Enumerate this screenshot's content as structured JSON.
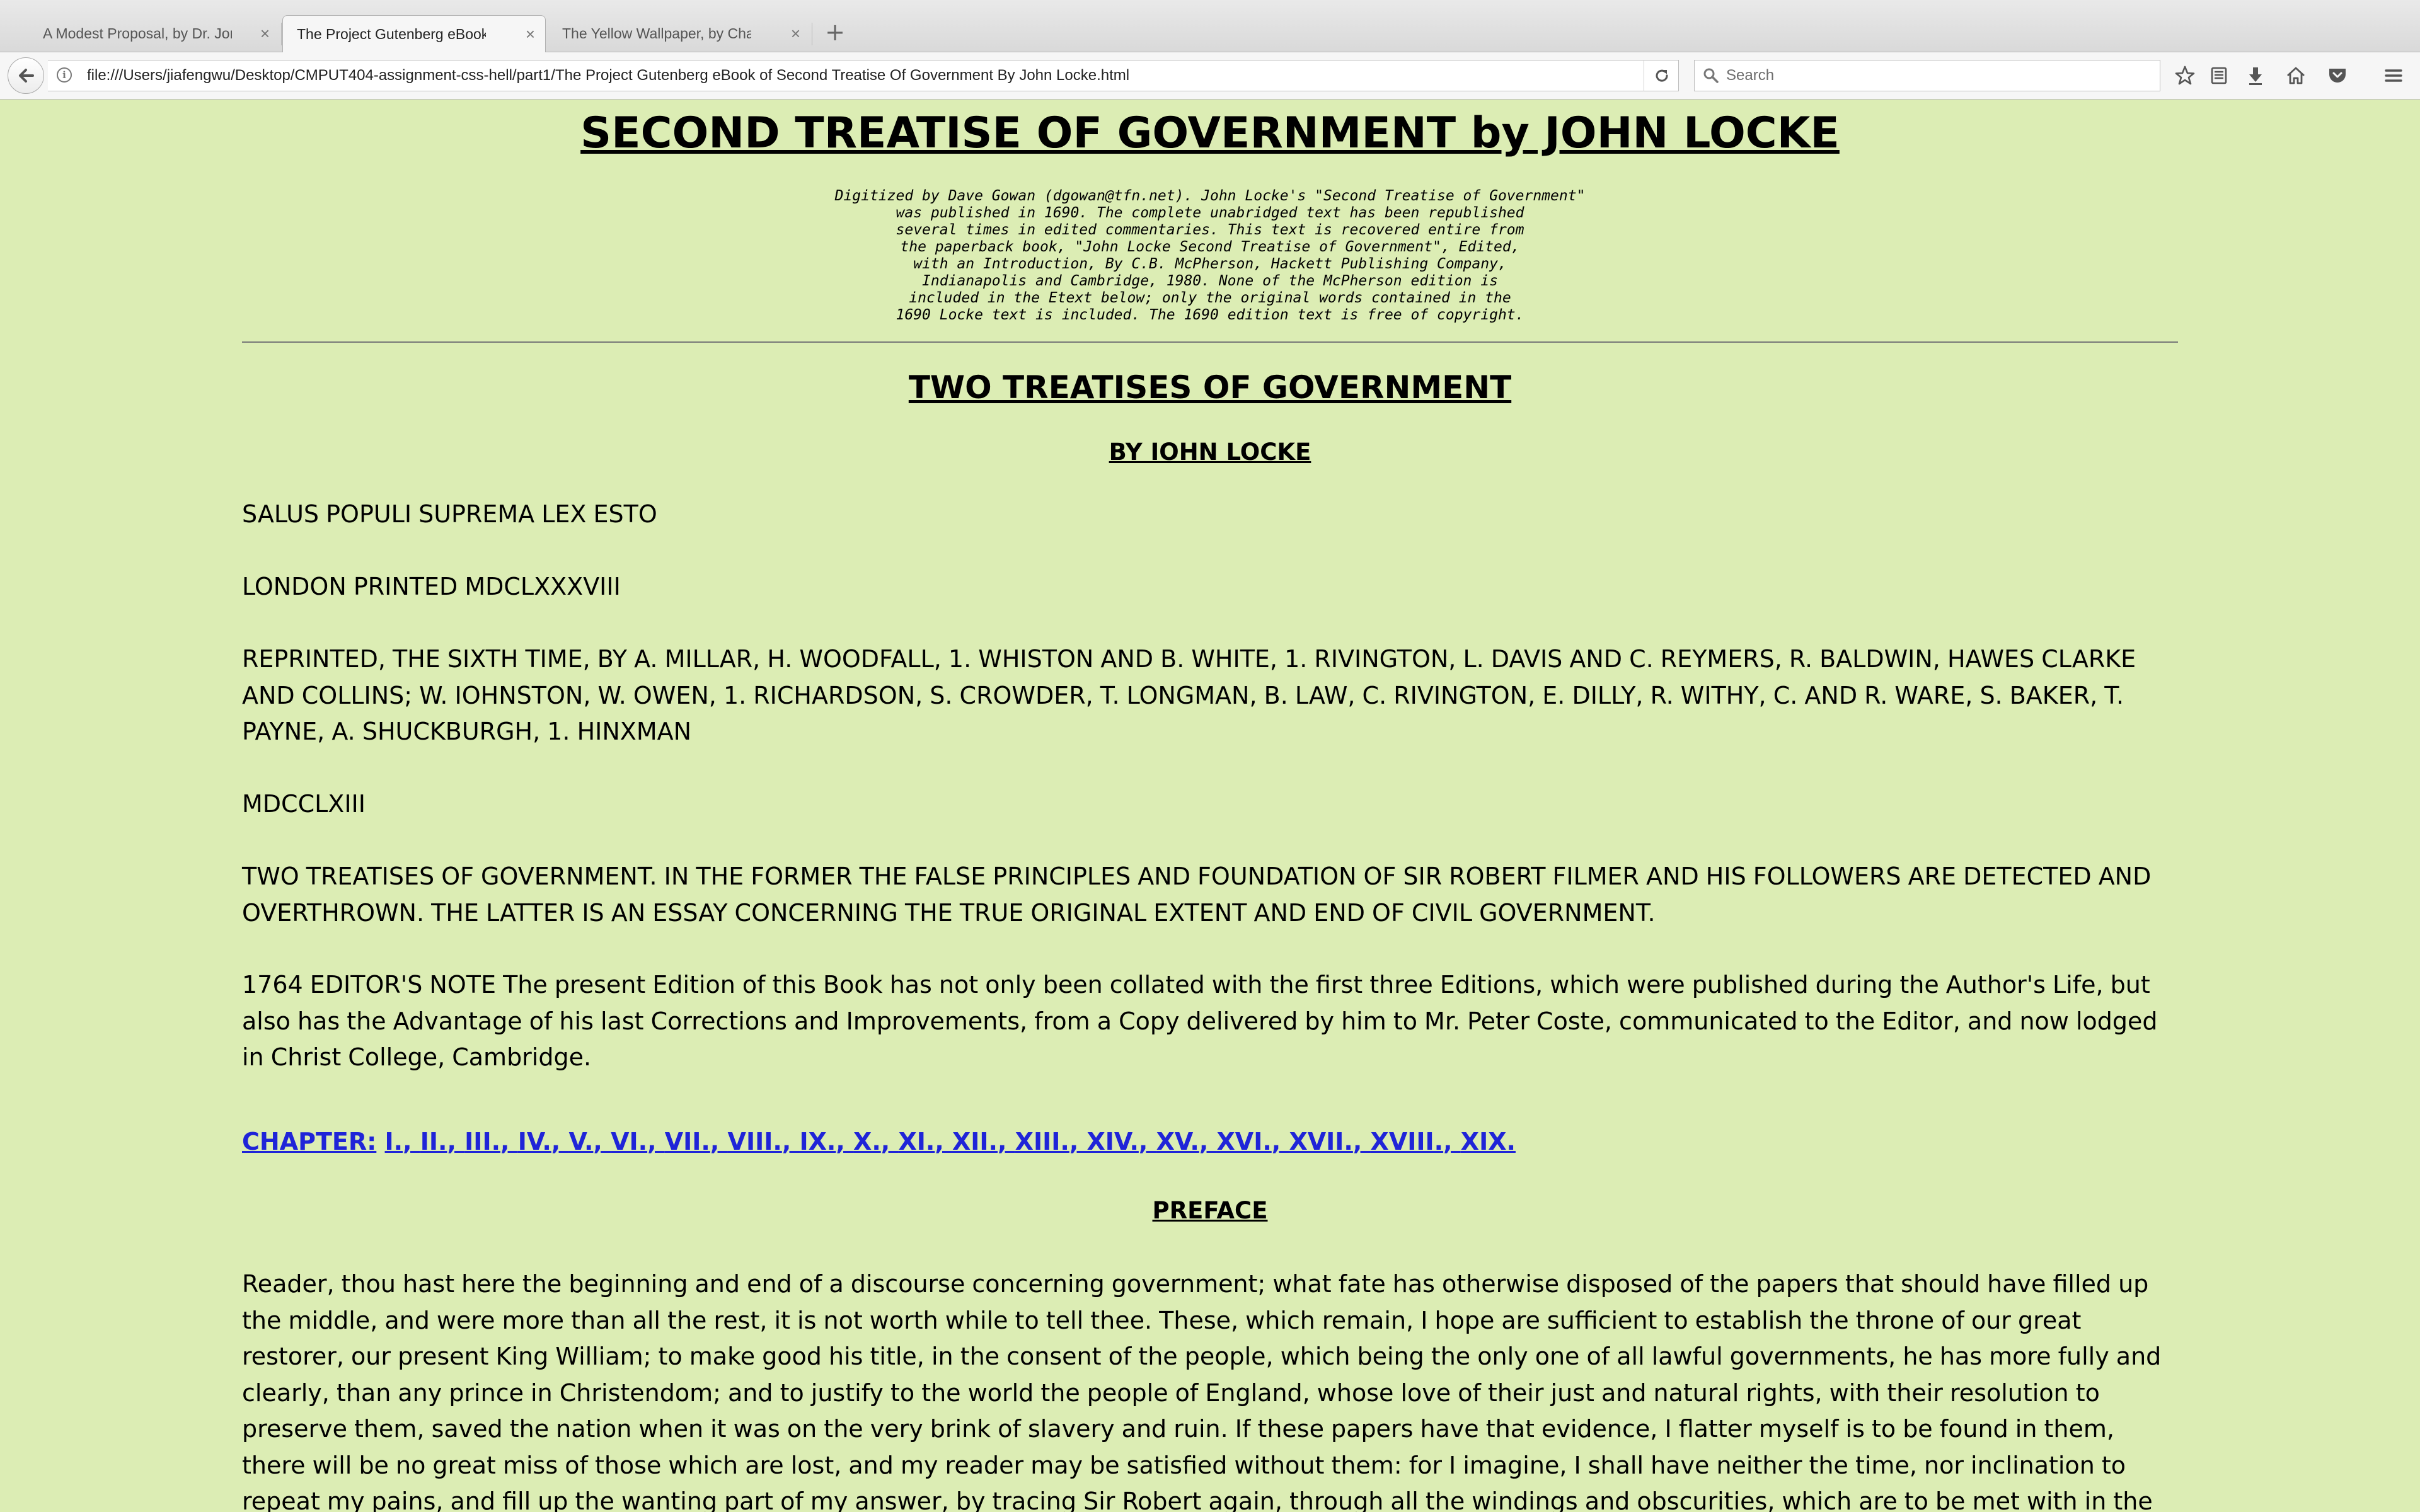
{
  "browser": {
    "tabs": [
      {
        "label": "A Modest Proposal, by Dr. Jona...",
        "active": false
      },
      {
        "label": "The Project Gutenberg eBook o...",
        "active": true
      },
      {
        "label": "The Yellow Wallpaper, by Charl...",
        "active": false
      }
    ],
    "close_glyph": "×",
    "new_tab_glyph": "+",
    "url": "file:///Users/jiafengwu/Desktop/CMPUT404-assignment-css-hell/part1/The Project Gutenberg eBook of Second Treatise Of Government By John Locke.html",
    "search_placeholder": "Search",
    "toolbar_icons": [
      "bookmark-star-icon",
      "reading-list-icon",
      "download-icon",
      "home-icon",
      "pocket-icon",
      "menu-icon"
    ]
  },
  "document": {
    "title": "SECOND TREATISE OF GOVERNMENT by JOHN LOCKE",
    "digitized_note": "Digitized by Dave Gowan (dgowan@tfn.net). John Locke's \"Second Treatise of Government\"\nwas published in 1690. The complete unabridged text has been republished\nseveral times in edited commentaries. This text is recovered entire from\nthe paperback book, \"John Locke Second Treatise of Government\", Edited,\nwith an Introduction, By C.B. McPherson, Hackett Publishing Company,\nIndianapolis and Cambridge, 1980. None of the McPherson edition is\nincluded in the Etext below; only the original words contained in the\n1690 Locke text is included. The 1690 edition text is free of copyright.",
    "heading": "TWO TREATISES OF GOVERNMENT",
    "byline": "BY IOHN LOCKE",
    "motto": "SALUS POPULI SUPREMA LEX ESTO",
    "imprint": "LONDON PRINTED MDCLXXXVIII",
    "reprint": "REPRINTED, THE SIXTH TIME, BY A. MILLAR, H. WOODFALL, 1. WHISTON AND B. WHITE, 1. RIVINGTON, L. DAVIS AND C. REYMERS, R. BALDWIN, HAWES CLARKE AND COLLINS; W. IOHNSTON, W. OWEN, 1. RICHARDSON, S. CROWDER, T. LONGMAN, B. LAW, C. RIVINGTON, E. DILLY, R. WITHY, C. AND R. WARE, S. BAKER, T. PAYNE, A. SHUCKBURGH, 1. HINXMAN",
    "year": "MDCCLXIII",
    "full_title": "TWO TREATISES OF GOVERNMENT. IN THE FORMER THE FALSE PRINCIPLES AND FOUNDATION OF SIR ROBERT FILMER AND HIS FOLLOWERS ARE DETECTED AND OVERTHROWN. THE LATTER IS AN ESSAY CONCERNING THE TRUE ORIGINAL EXTENT AND END OF CIVIL GOVERNMENT.",
    "editor_note": "1764 EDITOR'S NOTE The present Edition of this Book has not only been collated with the first three Editions, which were published during the Author's Life, but also has the Advantage of his last Corrections and Improvements, from a Copy delivered by him to Mr. Peter Coste, communicated to the Editor, and now lodged in Christ College, Cambridge.",
    "chapter_prefix": "CHAPTER:",
    "chapters": [
      "I.",
      "II.",
      "III.",
      "IV.",
      "V.",
      "VI.",
      "VII.",
      "VIII.",
      "IX.",
      "X.",
      "XI.",
      "XII.",
      "XIII.",
      "XIV.",
      "XV.",
      "XVI.",
      "XVII.",
      "XVIII.",
      "XIX."
    ],
    "chapter_separator": ", ",
    "preface_heading": "PREFACE",
    "preface_text": "Reader, thou hast here the beginning and end of a discourse concerning government; what fate has otherwise disposed of the papers that should have filled up the middle, and were more than all the rest, it is not worth while to tell thee. These, which remain, I hope are sufficient to establish the throne of our great restorer, our present King William; to make good his title, in the consent of the people, which being the only one of all lawful governments, he has more fully and clearly, than any prince in Christendom; and to justify to the world the people of England, whose love of their just and natural rights, with their resolution to preserve them, saved the nation when it was on the very brink of slavery and ruin. If these papers have that evidence, I flatter myself is to be found in them, there will be no great miss of those which are lost, and my reader may be satisfied without them: for I imagine, I shall have neither the time, nor inclination to repeat my pains, and fill up the wanting part of my answer, by tracing Sir Robert again, through all the windings and obscurities, which are to be met with in the several branches of his wonderful system. The king, and body of the"
  },
  "colors": {
    "page_background": "#dcedb4",
    "link": "#1f24d8",
    "chrome_background": "#f6f6f6"
  }
}
